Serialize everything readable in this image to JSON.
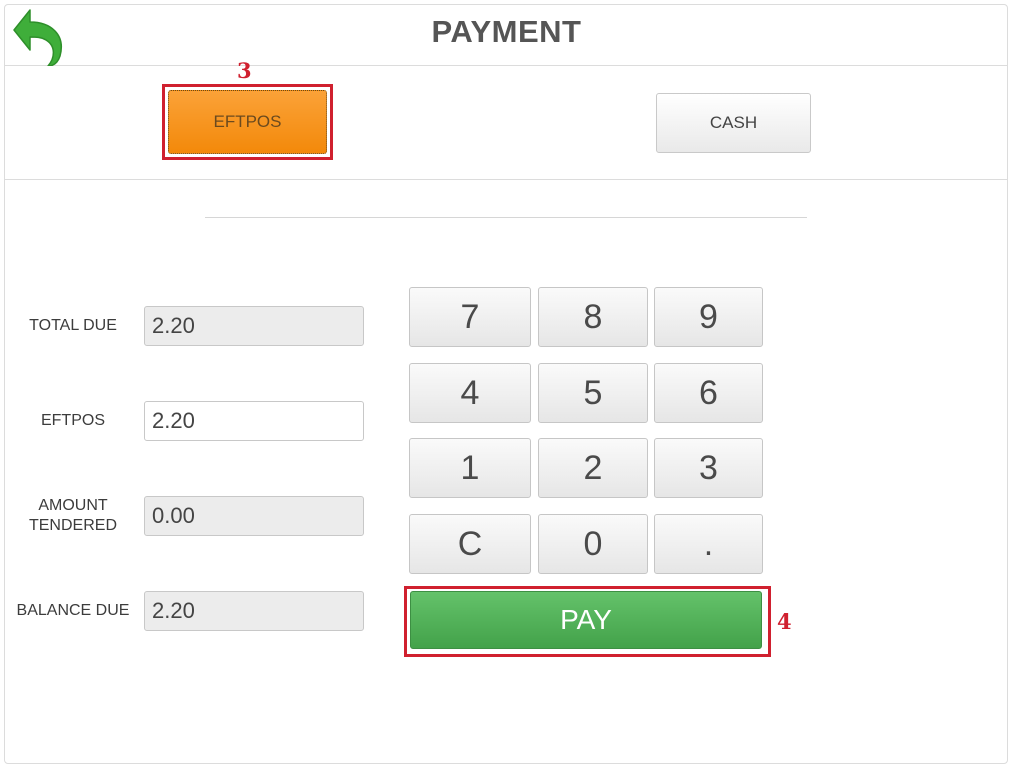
{
  "header": {
    "title": "PAYMENT",
    "back_icon": "back-arrow-icon"
  },
  "payment_methods": [
    {
      "label": "EFTPOS",
      "selected": true
    },
    {
      "label": "CASH",
      "selected": false
    }
  ],
  "fields": {
    "total_due": {
      "label": "TOTAL DUE",
      "value": "2.20"
    },
    "eftpos": {
      "label": "EFTPOS",
      "value": "2.20"
    },
    "amount_tendered": {
      "label_line1": "AMOUNT",
      "label_line2": "TENDERED",
      "value": "0.00"
    },
    "balance_due": {
      "label": "BALANCE DUE",
      "value": "2.20"
    }
  },
  "keypad": {
    "keys": [
      "7",
      "8",
      "9",
      "4",
      "5",
      "6",
      "1",
      "2",
      "3",
      "C",
      "0",
      "."
    ],
    "pay_label": "PAY"
  },
  "annotations": {
    "eftpos_marker": "3",
    "pay_marker": "4"
  },
  "colors": {
    "selected_method": "#f7941d",
    "pay_button": "#4cae52",
    "annotation": "#d0202f",
    "back_arrow": "#3fae3a"
  }
}
